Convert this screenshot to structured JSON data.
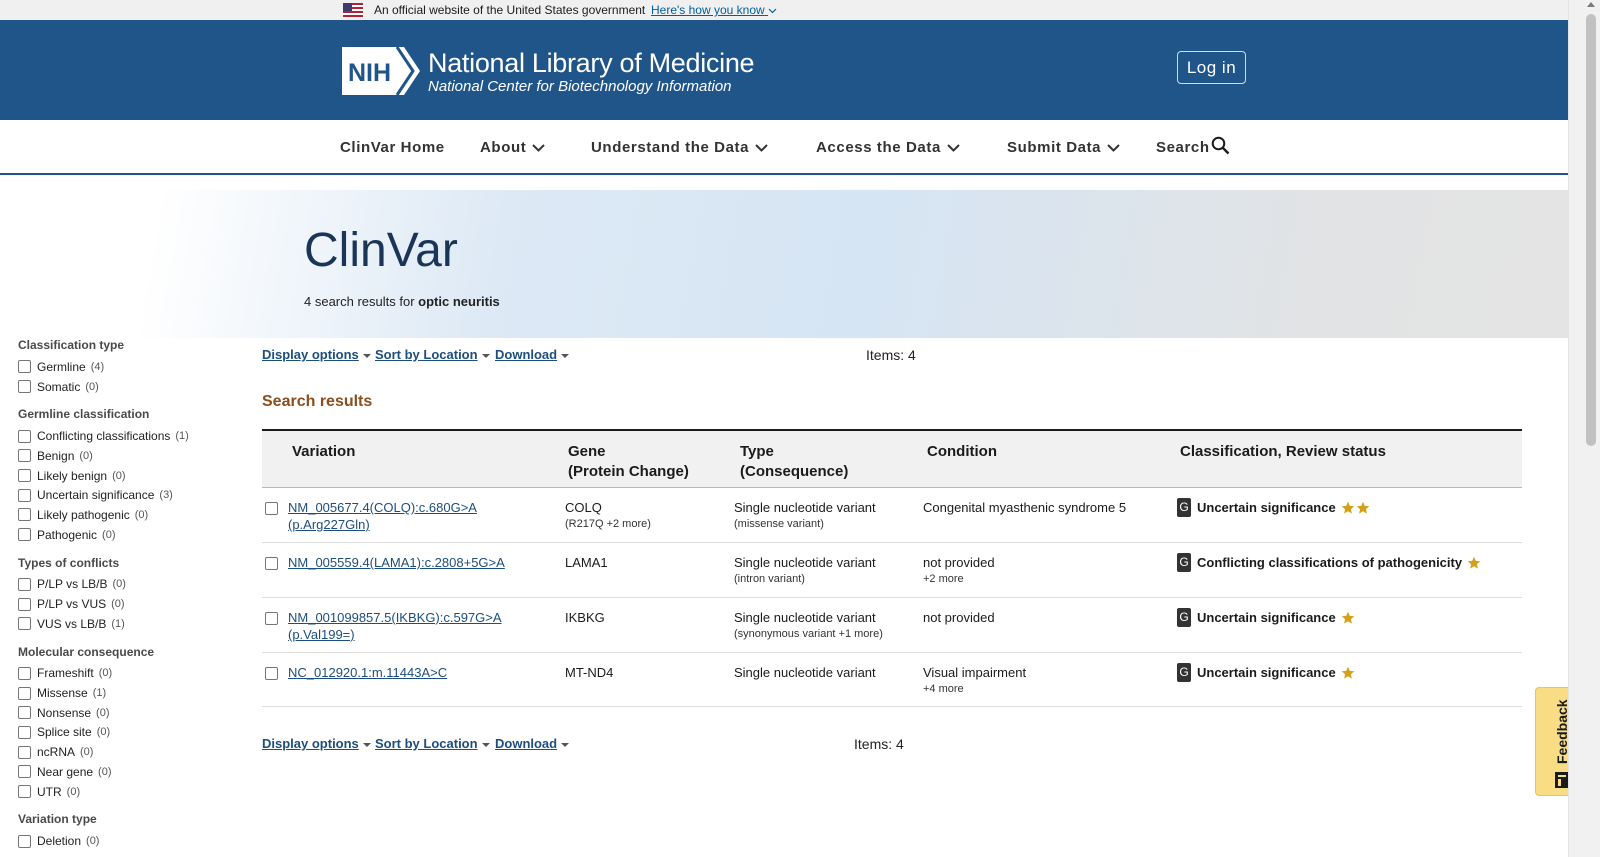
{
  "gov_banner": {
    "text": "An official website of the United States government",
    "link": "Here's how you know"
  },
  "header": {
    "logo_text": "NIH",
    "title": "National Library of Medicine",
    "subtitle": "National Center for Biotechnology Information",
    "login_label": "Log in"
  },
  "nav": {
    "items": [
      {
        "label": "ClinVar Home"
      },
      {
        "label": "About"
      },
      {
        "label": "Understand the Data"
      },
      {
        "label": "Access the Data"
      },
      {
        "label": "Submit Data"
      },
      {
        "label": "Search"
      }
    ]
  },
  "hero": {
    "title": "ClinVar",
    "results_prefix": "4 search results for",
    "query": "optic neuritis"
  },
  "facets": [
    {
      "title": "Classification type",
      "items": [
        {
          "label": "Germline",
          "count": "(4)"
        },
        {
          "label": "Somatic",
          "count": "(0)"
        }
      ]
    },
    {
      "title": "Germline classification",
      "items": [
        {
          "label": "Conflicting classifications",
          "count": "(1)"
        },
        {
          "label": "Benign",
          "count": "(0)"
        },
        {
          "label": "Likely benign",
          "count": "(0)"
        },
        {
          "label": "Uncertain significance",
          "count": "(3)"
        },
        {
          "label": "Likely pathogenic",
          "count": "(0)"
        },
        {
          "label": "Pathogenic",
          "count": "(0)"
        }
      ]
    },
    {
      "title": "Types of conflicts",
      "items": [
        {
          "label": "P/LP vs LB/B",
          "count": "(0)"
        },
        {
          "label": "P/LP vs VUS",
          "count": "(0)"
        },
        {
          "label": "VUS vs LB/B",
          "count": "(1)"
        }
      ]
    },
    {
      "title": "Molecular consequence",
      "items": [
        {
          "label": "Frameshift",
          "count": "(0)"
        },
        {
          "label": "Missense",
          "count": "(1)"
        },
        {
          "label": "Nonsense",
          "count": "(0)"
        },
        {
          "label": "Splice site",
          "count": "(0)"
        },
        {
          "label": "ncRNA",
          "count": "(0)"
        },
        {
          "label": "Near gene",
          "count": "(0)"
        },
        {
          "label": "UTR",
          "count": "(0)"
        }
      ]
    },
    {
      "title": "Variation type",
      "items": [
        {
          "label": "Deletion",
          "count": "(0)"
        }
      ]
    }
  ],
  "toolbar": {
    "display_options": "Display options",
    "sort": "Sort by Location",
    "download": "Download",
    "items": "Items: 4"
  },
  "results_heading": "Search results",
  "table": {
    "headers": {
      "variation": "Variation",
      "gene": "Gene",
      "gene_sub": "(Protein Change)",
      "type": "Type",
      "type_sub": "(Consequence)",
      "condition": "Condition",
      "classification": "Classification, Review status"
    },
    "rows": [
      {
        "variation": "NM_005677.4(COLQ):c.680G>A (p.Arg227Gln)",
        "gene": "COLQ",
        "protein": "(R217Q +2 more)",
        "type": "Single nucleotide variant",
        "consequence": "(missense variant)",
        "condition": "Congenital myasthenic syndrome 5",
        "condition_more": "",
        "badge": "G",
        "classification": "Uncertain significance",
        "stars": 2
      },
      {
        "variation": "NM_005559.4(LAMA1):c.2808+5G>A",
        "gene": "LAMA1",
        "protein": "",
        "type": "Single nucleotide variant",
        "consequence": "(intron variant)",
        "condition": "not provided",
        "condition_more": "+2 more",
        "badge": "G",
        "classification": "Conflicting classifications of pathogenicity",
        "stars": 1
      },
      {
        "variation": "NM_001099857.5(IKBKG):c.597G>A (p.Val199=)",
        "gene": "IKBKG",
        "protein": "",
        "type": "Single nucleotide variant",
        "consequence": "(synonymous variant +1 more)",
        "condition": "not provided",
        "condition_more": "",
        "badge": "G",
        "classification": "Uncertain significance",
        "stars": 1
      },
      {
        "variation": "NC_012920.1:m.11443A>C",
        "gene": "MT-ND4",
        "protein": "",
        "type": "Single nucleotide variant",
        "consequence": "",
        "condition": "Visual impairment",
        "condition_more": "+4 more",
        "badge": "G",
        "classification": "Uncertain significance",
        "stars": 1
      }
    ]
  },
  "feedback": "Feedback",
  "colors": {
    "header_blue": "#20558a",
    "link_blue": "#1c4e7e",
    "heading_brown": "#8a4e1f",
    "star_gold": "#d4a017",
    "feedback_yellow": "#f8dd84"
  }
}
